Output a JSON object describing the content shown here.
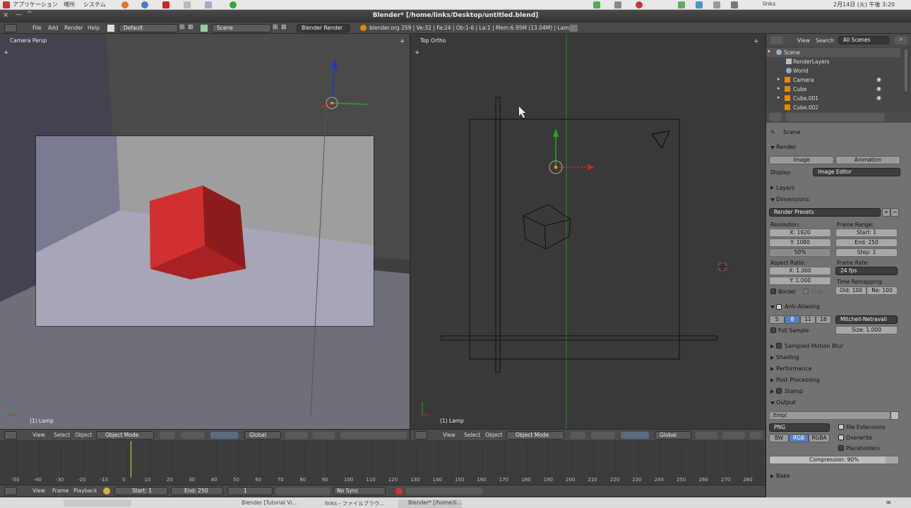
{
  "os_menu": {
    "applications": "アプリケーション",
    "places": "場所",
    "system": "システム",
    "user": "links",
    "clock": "2月14日 (火) 午後 3:20"
  },
  "window": {
    "title": "Blender* [/home/links/Desktop/untitled.blend]"
  },
  "info_header": {
    "menus": [
      "File",
      "Add",
      "Render",
      "Help"
    ],
    "screen_layout": "Default",
    "scene": "Scene",
    "engine": "Blender Render",
    "stats": "blender.org 259 | Ve:32 | Fa:24 | Ob:1-6 | La:1 | Mem:6.95M (13.04M) | Lamp"
  },
  "viewport_left": {
    "view_label": "Camera Persp",
    "object_label": "(1) Lamp"
  },
  "viewport_right": {
    "view_label": "Top Ortho",
    "object_label": "(1) Lamp"
  },
  "view3d_header": {
    "menus": [
      "View",
      "Select",
      "Object"
    ],
    "mode": "Object Mode",
    "orientation": "Global"
  },
  "outliner": {
    "menus": [
      "View",
      "Search"
    ],
    "filter": "All Scenes",
    "items": [
      "Scene",
      "RenderLayers",
      "World",
      "Camera",
      "Cube",
      "Cube.001",
      "Cube.002"
    ]
  },
  "properties": {
    "context": "Scene",
    "render": {
      "title": "Render",
      "image_btn": "Image",
      "animation_btn": "Animation",
      "display_label": "Display:",
      "display_value": "Image Editor"
    },
    "layers": "Layers",
    "dimensions": {
      "title": "Dimensions",
      "presets": "Render Presets",
      "resolution_label": "Resolution:",
      "res_x": "X: 1920",
      "res_y": "Y: 1080",
      "res_pct": "50%",
      "frame_range_label": "Frame Range:",
      "start": "Start: 1",
      "end": "End: 250",
      "step": "Step: 1",
      "aspect_label": "Aspect Ratio:",
      "aspect_x": "X: 1.000",
      "aspect_y": "Y: 1.000",
      "frame_rate_label": "Frame Rate:",
      "fps": "24 fps",
      "border": "Border",
      "crop": "Crop",
      "time_remap_label": "Time Remapping:",
      "old": "Old: 100",
      "new": "Ne: 100"
    },
    "aa": {
      "title": "Anti-Aliasing",
      "samples": [
        "5",
        "8",
        "11",
        "16"
      ],
      "filter": "Mitchell-Netravali",
      "full_sample": "Full Sample",
      "size": "Size: 1.000"
    },
    "sections": [
      "Sampled Motion Blur",
      "Shading",
      "Performance",
      "Post Processing",
      "Stamp"
    ],
    "output": {
      "title": "Output",
      "path": "/tmp/",
      "format": "PNG",
      "file_ext": "File Extensions",
      "overwrite": "Overwrite",
      "placeholders": "Placeholders",
      "bw": "BW",
      "rgb": "RGB",
      "rgba": "RGBA",
      "compression": "Compression: 90%"
    },
    "bake": "Bake"
  },
  "timeline": {
    "ticks": [
      "-50",
      "-40",
      "-30",
      "-20",
      "-10",
      "0",
      "10",
      "20",
      "30",
      "40",
      "50",
      "60",
      "70",
      "80",
      "90",
      "100",
      "110",
      "120",
      "130",
      "140",
      "150",
      "160",
      "170",
      "180",
      "190",
      "200",
      "210",
      "220",
      "230",
      "240",
      "250",
      "260",
      "270",
      "280"
    ],
    "menus": [
      "View",
      "Frame",
      "Playback"
    ],
    "start": "Start: 1",
    "end": "End: 250",
    "current": "1",
    "sync": "No Sync"
  },
  "taskbar": {
    "items": [
      "Blender [Tutorial Vi...",
      "links - ファイルブラウ...",
      "Blender* [/home/li..."
    ]
  },
  "colors": {
    "accent": "#5680c2",
    "cube_red": "#c0282a",
    "x_axis": "#d22020",
    "y_axis": "#1fa81f",
    "z_axis": "#2235c8"
  }
}
